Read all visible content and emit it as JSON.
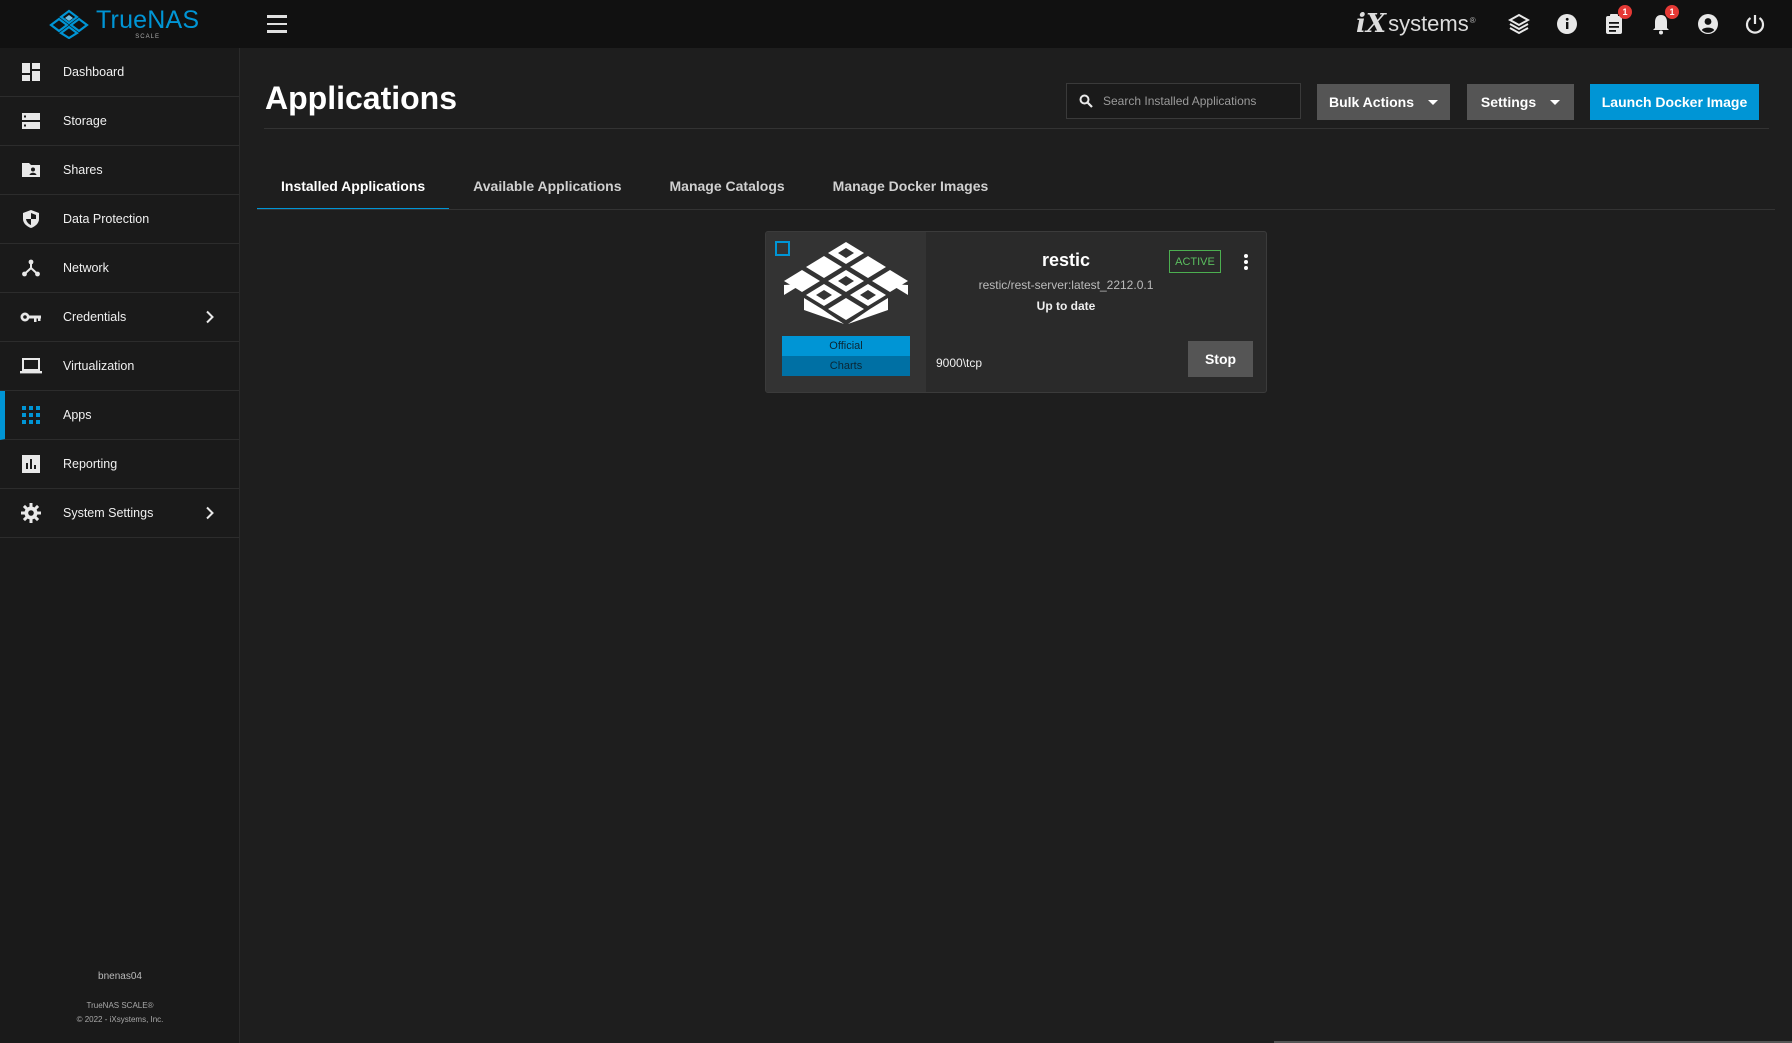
{
  "brand": {
    "name": "TrueNAS",
    "edition": "SCALE"
  },
  "topbar": {
    "vendor_logo_mark": "iX",
    "vendor_logo_word": "systems",
    "vendor_logo_tm": "®",
    "icons": [
      "truecommand-icon",
      "info-icon",
      "jobs-icon",
      "notifications-icon",
      "account-icon",
      "power-icon"
    ],
    "jobs_badge": "1",
    "notifications_badge": "1"
  },
  "sidebar": {
    "items": [
      {
        "label": "Dashboard",
        "icon": "dashboard-icon"
      },
      {
        "label": "Storage",
        "icon": "storage-icon"
      },
      {
        "label": "Shares",
        "icon": "shares-icon"
      },
      {
        "label": "Data Protection",
        "icon": "shield-icon"
      },
      {
        "label": "Network",
        "icon": "network-icon"
      },
      {
        "label": "Credentials",
        "icon": "key-icon"
      },
      {
        "label": "Virtualization",
        "icon": "laptop-icon"
      },
      {
        "label": "Apps",
        "icon": "apps-grid-icon"
      },
      {
        "label": "Reporting",
        "icon": "chart-icon"
      },
      {
        "label": "System Settings",
        "icon": "gear-icon"
      }
    ],
    "active": "Apps",
    "hostname": "bnenas04",
    "footer_product": "TrueNAS SCALE®",
    "footer_copyright": "© 2022 - iXsystems, Inc."
  },
  "header": {
    "title": "Applications",
    "search_placeholder": "Search Installed Applications",
    "bulk_actions_label": "Bulk Actions",
    "settings_label": "Settings",
    "launch_label": "Launch Docker Image"
  },
  "tabs": [
    {
      "label": "Installed Applications",
      "active": true
    },
    {
      "label": "Available Applications",
      "active": false
    },
    {
      "label": "Manage Catalogs",
      "active": false
    },
    {
      "label": "Manage Docker Images",
      "active": false
    }
  ],
  "app_card": {
    "name": "restic",
    "image": "restic/rest-server:latest_2212.0.1",
    "update_status": "Up to date",
    "status": "ACTIVE",
    "catalog_line1": "Official",
    "catalog_line2": "Charts",
    "ports": "9000\\tcp",
    "action_label": "Stop",
    "selected": false
  },
  "colors": {
    "accent": "#0095d5",
    "active_status": "#4caf50",
    "badge": "#e53935"
  }
}
